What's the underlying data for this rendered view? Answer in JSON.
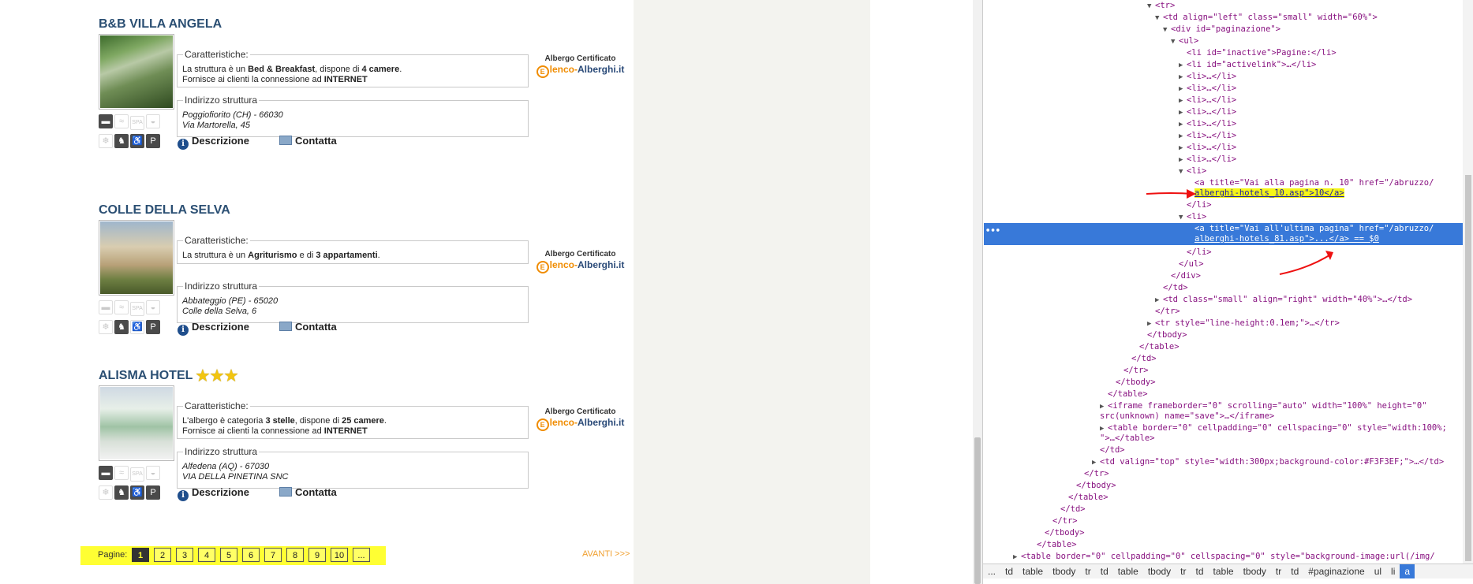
{
  "hotels": [
    {
      "name": "B&B VILLA ANGELA",
      "stars": 0,
      "features_label": "Caratteristiche:",
      "feature_line1": [
        "La struttura è un ",
        "Bed & Breakfast",
        ", dispone di ",
        "4 camere",
        "."
      ],
      "feature_line2": [
        "Fornisce ai clienti la connessione ad ",
        "INTERNET"
      ],
      "address_label": "Indirizzo struttura",
      "address_city": "Poggiofiorito (CH) - 66030",
      "address_street": "Via Martorella, 45",
      "desc_label": "Descrizione",
      "contact_label": "Contatta",
      "cert_label": "Albergo Certificato",
      "cert_brand_a": "lenco-",
      "cert_brand_b": "Alberghi.it"
    },
    {
      "name": "COLLE DELLA SELVA",
      "stars": 0,
      "features_label": "Caratteristiche:",
      "feature_line1": [
        "La struttura è un ",
        "Agriturismo",
        " e di ",
        "3 appartamenti",
        "."
      ],
      "feature_line2": [
        "",
        ""
      ],
      "address_label": "Indirizzo struttura",
      "address_city": "Abbateggio (PE) - 65020",
      "address_street": "Colle della Selva, 6",
      "desc_label": "Descrizione",
      "contact_label": "Contatta",
      "cert_label": "Albergo Certificato",
      "cert_brand_a": "lenco-",
      "cert_brand_b": "Alberghi.it"
    },
    {
      "name": "ALISMA HOTEL",
      "stars": 3,
      "features_label": "Caratteristiche:",
      "feature_line1": [
        "L'albergo è categoria ",
        "3 stelle",
        ", dispone di ",
        "25 camere",
        "."
      ],
      "feature_line2": [
        "Fornisce ai clienti la connessione ad ",
        "INTERNET"
      ],
      "address_label": "Indirizzo struttura",
      "address_city": "Alfedena (AQ) - 67030",
      "address_street": "VIA DELLA PINETINA SNC",
      "desc_label": "Descrizione",
      "contact_label": "Contatta",
      "cert_label": "Albergo Certificato",
      "cert_brand_a": "lenco-",
      "cert_brand_b": "Alberghi.it"
    }
  ],
  "feature_icon_text": {
    "spa": "SPA"
  },
  "pagination": {
    "label": "Pagine:",
    "pages": [
      "1",
      "2",
      "3",
      "4",
      "5",
      "6",
      "7",
      "8",
      "9",
      "10",
      "..."
    ],
    "active": "1",
    "next": "AVANTI >>>"
  },
  "devtools": {
    "lines": [
      "<tr>",
      "<td align=\"left\" class=\"small\" width=\"60%\">",
      "<div id=\"paginazione\">",
      "<ul>",
      "<li id=\"inactive\">Pagine:</li>",
      "<li id=\"activelink\">…</li>",
      "<li>…</li>",
      "<a title=\"Vai alla pagina n. 10\" href=\"/abruzzo/",
      "alberghi-hotels_10.asp\">10</a>",
      "<a title=\"Vai all'ultima pagina\" href=\"/abruzzo/",
      "alberghi-hotels_81.asp\">...</a> == $0"
    ],
    "breadcrumbs": [
      "...",
      "td",
      "table",
      "tbody",
      "tr",
      "td",
      "table",
      "tbody",
      "tr",
      "td",
      "table",
      "tbody",
      "tr",
      "td",
      "#paginazione",
      "ul",
      "li",
      "a"
    ],
    "colors": {
      "selection": "#3879d9",
      "highlight": "#f5f518",
      "tag": "#881280",
      "attr": "#994500",
      "value": "#1a1aa6"
    }
  }
}
